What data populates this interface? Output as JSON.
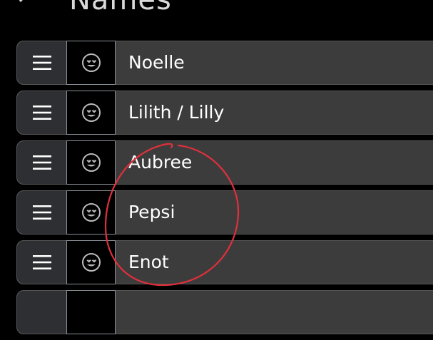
{
  "header": {
    "title": "Names"
  },
  "names": [
    {
      "label": "Noelle"
    },
    {
      "label": "Lilith / Lilly"
    },
    {
      "label": "Aubree"
    },
    {
      "label": "Pepsi"
    },
    {
      "label": "Enot"
    },
    {
      "label": ""
    }
  ],
  "colors": {
    "annotation": "#e0303c",
    "row_bg": "#3c3c3c",
    "handle_bg": "#2d2f33"
  },
  "icons": {
    "handle": "hamburger-icon",
    "emoji": "heart-eyes-emoji-icon"
  }
}
